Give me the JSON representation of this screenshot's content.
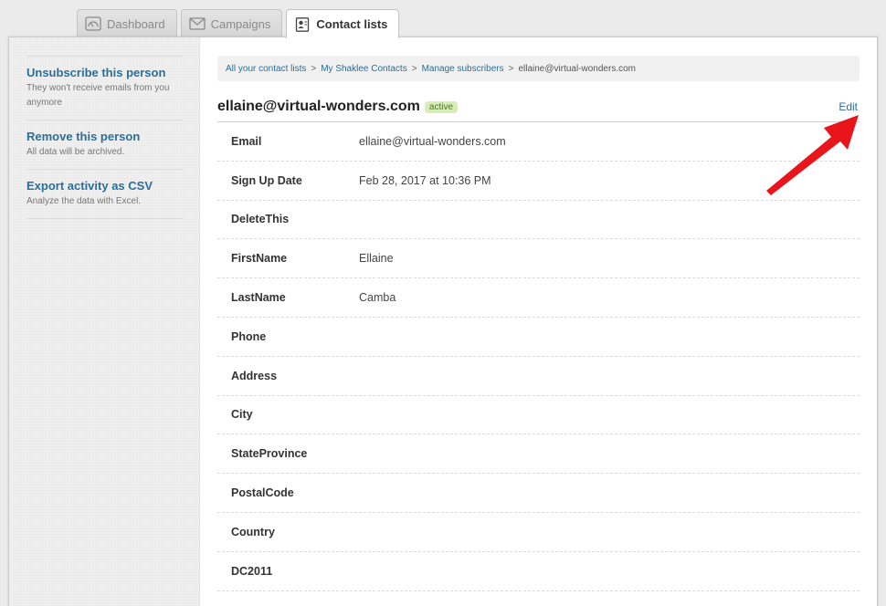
{
  "tabs": [
    {
      "label": "Dashboard",
      "icon": "dashboard-icon",
      "active": false
    },
    {
      "label": "Campaigns",
      "icon": "envelope-icon",
      "active": false
    },
    {
      "label": "Contact lists",
      "icon": "contact-card-icon",
      "active": true
    }
  ],
  "sidebar": {
    "items": [
      {
        "label": "Unsubscribe this person",
        "desc": "They won't receive emails from you anymore"
      },
      {
        "label": "Remove this person",
        "desc": "All data will be archived."
      },
      {
        "label": "Export activity as CSV",
        "desc": "Analyze the data with Excel."
      }
    ]
  },
  "breadcrumb": {
    "items": [
      "All your contact lists",
      "My Shaklee Contacts",
      "Manage subscribers"
    ],
    "current": "ellaine@virtual-wonders.com",
    "separator": ">"
  },
  "header": {
    "title": "ellaine@virtual-wonders.com",
    "status": "active",
    "edit_label": "Edit"
  },
  "fields": [
    {
      "label": "Email",
      "value": "ellaine@virtual-wonders.com"
    },
    {
      "label": "Sign Up Date",
      "value": "Feb 28, 2017 at 10:36 PM"
    },
    {
      "label": "DeleteThis",
      "value": ""
    },
    {
      "label": "FirstName",
      "value": "Ellaine"
    },
    {
      "label": "LastName",
      "value": "Camba"
    },
    {
      "label": "Phone",
      "value": ""
    },
    {
      "label": "Address",
      "value": ""
    },
    {
      "label": "City",
      "value": ""
    },
    {
      "label": "StateProvince",
      "value": ""
    },
    {
      "label": "PostalCode",
      "value": ""
    },
    {
      "label": "Country",
      "value": ""
    },
    {
      "label": "DC2011",
      "value": ""
    }
  ],
  "colors": {
    "link": "#2a6e9a",
    "badge_bg": "#d8ecb8",
    "annotation_arrow": "#e8161b"
  }
}
